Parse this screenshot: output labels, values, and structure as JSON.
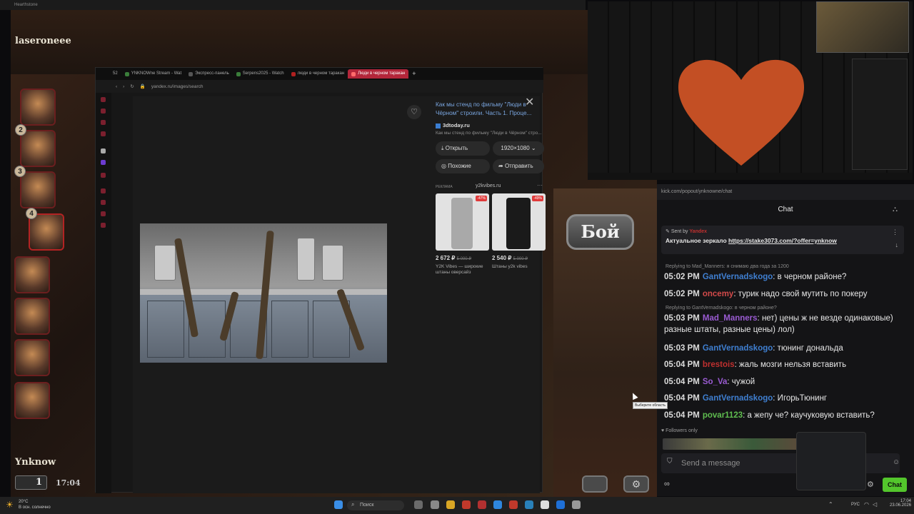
{
  "window": {
    "app_title": "Hearthstone"
  },
  "game": {
    "streamer_top": "laseroneee",
    "streamer_bottom": "Ynknow",
    "badges": [
      "2",
      "3",
      "4"
    ],
    "bottom_count": "1",
    "timer": "17:04",
    "battle_button": "Бой"
  },
  "browser": {
    "tabs": [
      {
        "label": "52",
        "color": "#333333"
      },
      {
        "label": "YNKNOWne Stream - Wat",
        "color": "#3a7d3a"
      },
      {
        "label": "Экспресс-панель",
        "color": "#555555"
      },
      {
        "label": "Serpens2025 - Watch",
        "color": "#3a7d3a"
      },
      {
        "label": "люди в черном таракан",
        "color": "#b02020"
      },
      {
        "label": "Люди в черном таракан",
        "color": "#b02020",
        "active": true
      }
    ],
    "url": "yandex.ru/images/search",
    "result": {
      "title": "Как мы стенд по фильму \"Люди в Чёрном\" строили. Часть 1. Проце...",
      "site": "3dtoday.ru",
      "snippet": "Как мы стенд по фильму \"Люди в Чёрном\" стро...",
      "open_label": "Открыть",
      "size_label": "1920×1080",
      "similar_label": "Похожие",
      "share_label": "Отправить"
    },
    "ad": {
      "tag": "РЕКЛАМА",
      "site": "y2kvibes.ru",
      "items": [
        {
          "discount": "-47%",
          "price": "2 672 ₽",
          "old_price": "5 000 ₽",
          "name": "Y2K Vibes — широкие штаны оверсайз"
        },
        {
          "discount": "-49%",
          "price": "2 540 ₽",
          "old_price": "5 000 ₽",
          "name": "Штаны y2k vibes"
        }
      ]
    }
  },
  "chat": {
    "url": "kick.com/popout/ynknowne/chat",
    "header": "Chat",
    "pinned": {
      "sent_by": "Sent by",
      "sender": "Yandex",
      "text": "Актуальное зеркало",
      "link": "https://stake3073.com/?offer=ynknow"
    },
    "messages": [
      {
        "reply": "Replying to Mad_Manners: я снимаю два года за 1200"
      },
      {
        "time": "05:02 PM",
        "user": "GantVernadskogo",
        "cls": "u-blue",
        "text": "в черном районе?"
      },
      {
        "time": "05:02 PM",
        "user": "oncemy",
        "cls": "u-orange",
        "text": "турик надо свой мутить по покеру"
      },
      {
        "reply": "Replying to GantVernadskogo: в черном районе?"
      },
      {
        "time": "05:03 PM",
        "user": "Mad_Manners",
        "cls": "u-purple",
        "text": "нет) цены ж не везде одинаковые) разные штаты, разные цены) лол)"
      },
      {
        "time": "05:03 PM",
        "user": "GantVernadskogo",
        "cls": "u-blue",
        "text": "тюнинг дональда"
      },
      {
        "time": "05:04 PM",
        "user": "brestois",
        "cls": "u-red",
        "text": "жаль мозги нельзя вставить"
      },
      {
        "time": "05:04 PM",
        "user": "So_Va",
        "cls": "u-purple",
        "text": "чужой"
      },
      {
        "time": "05:04 PM",
        "user": "GantVernadskogo",
        "cls": "u-blue",
        "text": "ИгорьТюнинг"
      },
      {
        "time": "05:04 PM",
        "user": "povar1123",
        "cls": "u-green",
        "text": "а жепу че? каучуковую вставить?"
      }
    ],
    "followers_only": "Followers only",
    "input_placeholder": "Send a message",
    "chat_button": "Chat"
  },
  "tooltip": "Выберите область",
  "taskbar": {
    "weather_temp": "20°C",
    "weather_desc": "В осн. солнечно",
    "search": "Поиск",
    "lang": "РУС",
    "time": "17:04",
    "date": "23.06.2026"
  }
}
